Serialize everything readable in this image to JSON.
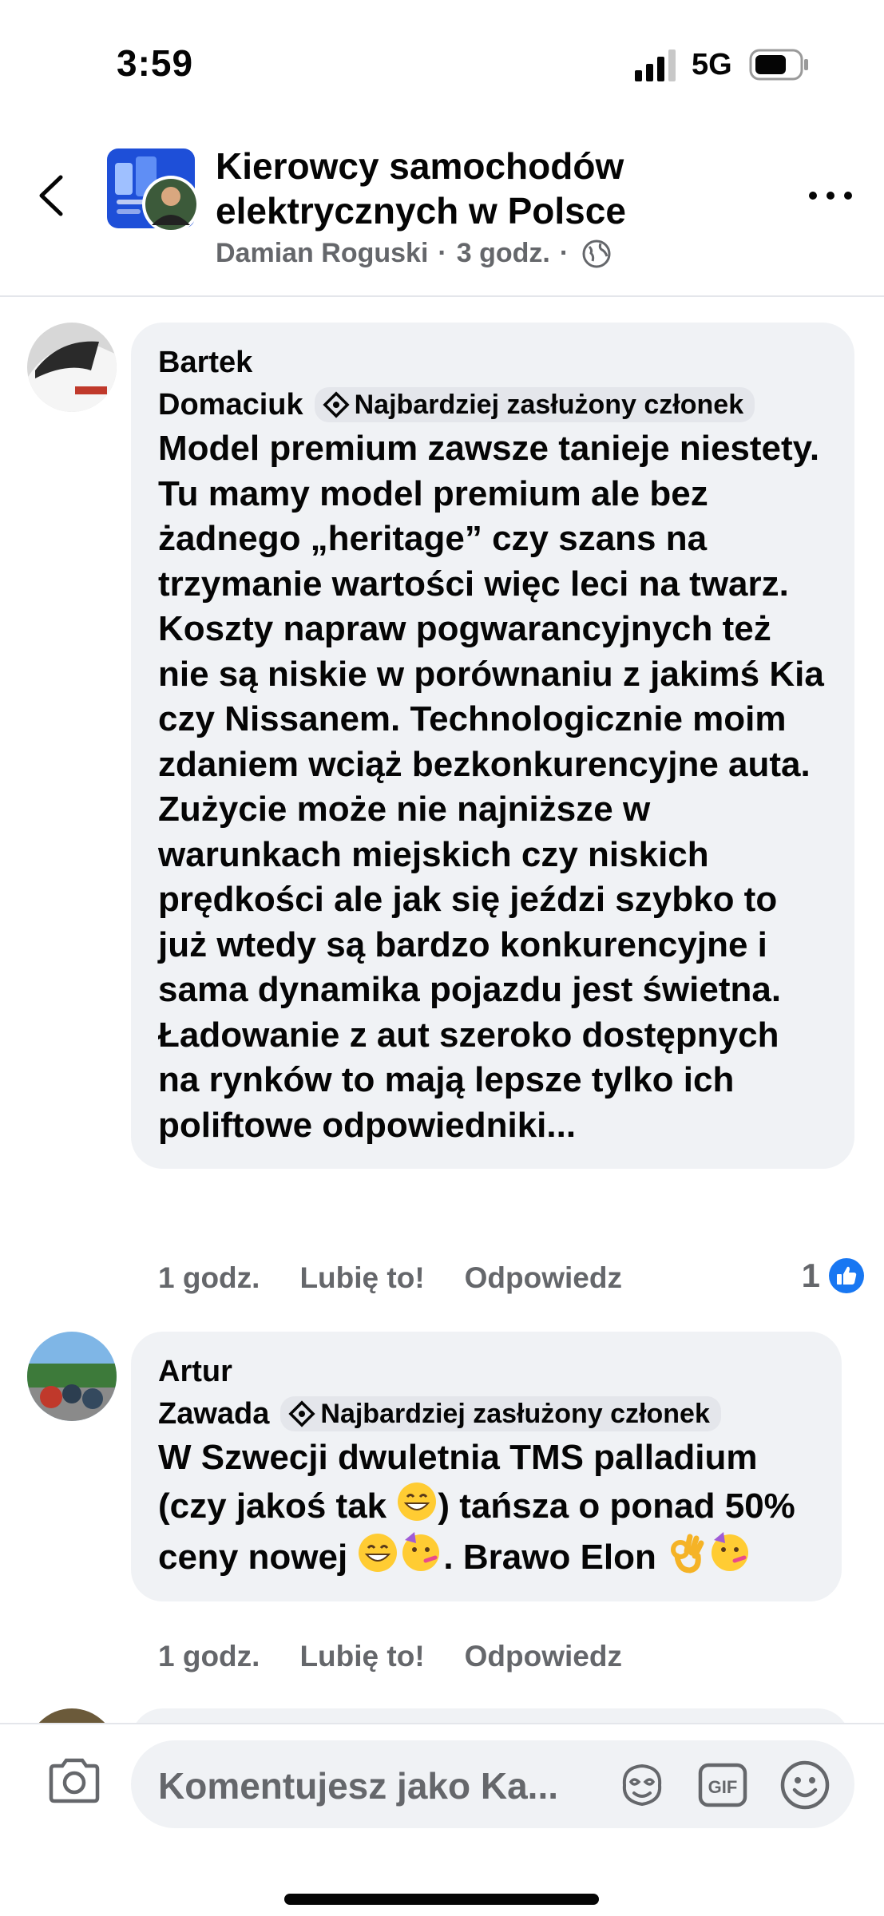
{
  "status_bar": {
    "time": "3:59",
    "network": "5G"
  },
  "header": {
    "title": "Kierowcy samochodów elektrycznych w Polsce",
    "author": "Damian Roguski",
    "time": "3 godz.",
    "separator": "·"
  },
  "comments": [
    {
      "author_first": "Bartek",
      "author_last": "Domaciuk",
      "badge": "Najbardziej zasłużony członek",
      "text": "Model premium zawsze tanieje niestety. Tu mamy model premium ale bez żadnego „heritage” czy szans na trzymanie wartości więc leci na twarz. Koszty napraw pogwarancyjnych też nie są niskie w porównaniu z jakimś Kia czy Nissanem. Technologicznie moim zdaniem wciąż bezkonkurencyjne auta. Zużycie może nie najniższe w warunkach miejskich czy niskich prędkości ale jak się jeździ szybko to już wtedy są bardzo konkurencyjne i sama dynamika pojazdu jest świetna. Ładowanie z aut szeroko dostępnych na rynków to mają lepsze tylko ich poliftowe odpowiedniki...",
      "time": "1 godz.",
      "like_label": "Lubię to!",
      "reply_label": "Odpowiedz",
      "reaction_count": "1"
    },
    {
      "author_first": "Artur",
      "author_last": "Zawada",
      "badge": "Najbardziej zasłużony członek",
      "text_part1": "W Szwecji dwuletnia TMS palladium (czy jakoś tak ",
      "text_part2": ") tańsza o ponad 50% ceny nowej ",
      "text_part3": ". Brawo Elon ",
      "time": "1 godz.",
      "like_label": "Lubię to!",
      "reply_label": "Odpowiedz"
    }
  ],
  "composer": {
    "placeholder": "Komentujesz jako Ka..."
  },
  "icons": {
    "back": "back-chevron-icon",
    "more": "more-dots-icon",
    "globe": "globe-icon",
    "camera": "camera-icon",
    "avatar_sticker": "avatar-sticker-icon",
    "gif": "gif-icon",
    "emoji": "emoji-icon",
    "badge": "diamond-badge-icon",
    "like": "like-thumb-icon"
  },
  "colors": {
    "bubble": "#f0f2f5",
    "secondary_text": "#65676b",
    "like_blue": "#1877f2"
  }
}
